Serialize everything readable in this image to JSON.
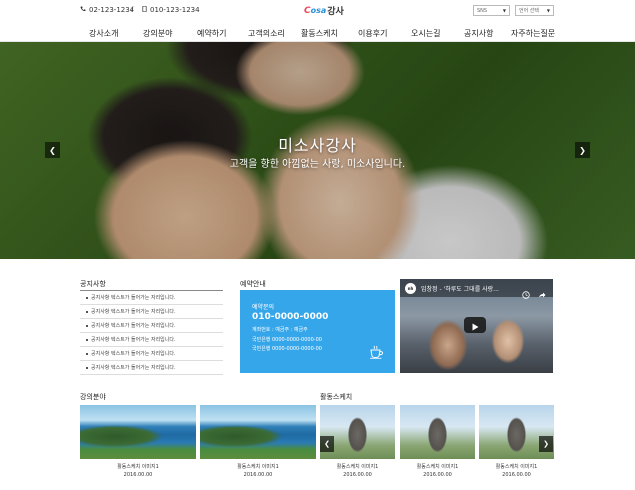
{
  "header": {
    "phone1": "02-123-1234",
    "separator": "/",
    "phone2": "010-123-1234",
    "logo_part1": "C",
    "logo_part2": "osa",
    "logo_part3": "강사",
    "select1": "SNS",
    "select2": "언어 선택"
  },
  "nav": {
    "items": [
      "강사소개",
      "강의분야",
      "예약하기",
      "고객의소리",
      "활동스케치",
      "이용후기",
      "오시는길",
      "공지사항",
      "자주하는질문"
    ]
  },
  "hero": {
    "title": "미소사강사",
    "subtitle": "고객을 향한 아낌없는 사랑, 미소사입니다."
  },
  "notice": {
    "title": "공지사항",
    "rows": [
      "공지사항 텍스트가 들어가는 자리입니다.",
      "공지사항 텍스트가 들어가는 자리입니다.",
      "공지사항 텍스트가 들어가는 자리입니다.",
      "공지사항 텍스트가 들어가는 자리입니다.",
      "공지사항 텍스트가 들어가는 자리입니다.",
      "공지사항 텍스트가 들어가는 자리입니다."
    ]
  },
  "reservation": {
    "title": "예약안내",
    "inquiry_label": "예약문의",
    "phone": "010-0000-0000",
    "account_holder": "계좌번호 : 예금주 : 예금주",
    "bank1": "국민은행 0000-0000-0000-00",
    "bank2": "국민은행 0000-0000-0000-00"
  },
  "video": {
    "logo": "nh",
    "title": "임창정 - '하루도 그대를 사랑..."
  },
  "lectures": {
    "title": "강의분야",
    "cards": [
      {
        "caption": "활동스케치 이미지1",
        "date": "2016.00.00"
      },
      {
        "caption": "활동스케치 이미지1",
        "date": "2016.00.00"
      }
    ]
  },
  "sketch": {
    "title": "활동스케치",
    "cards": [
      {
        "caption": "활동스케치 이미지1",
        "date": "2016.00.00"
      },
      {
        "caption": "활동스케치 이미지1",
        "date": "2016.00.00"
      },
      {
        "caption": "활동스케치 이미지1",
        "date": "2016.00.00"
      }
    ]
  },
  "colors": {
    "accent_blue": "#36a6ea",
    "logo_red": "#e84a5f",
    "logo_blue": "#2a8fd8"
  }
}
